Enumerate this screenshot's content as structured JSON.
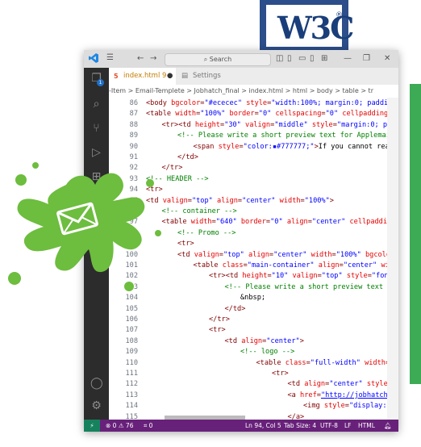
{
  "badge": {
    "w3c": "W3C",
    "reg": "®"
  },
  "titlebar": {
    "search_label": "Search"
  },
  "activity": {
    "badge_count": "1"
  },
  "tabs": [
    {
      "label": "index.html 9+",
      "dot": "●",
      "icon": "html-file-icon"
    },
    {
      "label": "Settings",
      "icon": "settings-file-icon"
    }
  ],
  "breadcrumb": {
    "text": "-Item > Email-Templete > Jobhatch_final > index.html > html > body > table > tr"
  },
  "lines": [
    {
      "n": "86",
      "indent": 0,
      "html": "<span class='tag'>&lt;body</span> <span class='attr'>bgcolor</span>=<span class='val'>\"#ececec\"</span> <span class='attr'>style</span>=<span class='val'>\"width:100%; margin:0; padding:0;\"</span>"
    },
    {
      "n": "87",
      "indent": 0,
      "html": "<span class='tag'>&lt;table</span> <span class='attr'>width</span>=<span class='val'>\"100%\"</span> <span class='attr'>border</span>=<span class='val'>\"0\"</span> <span class='attr'>cellspacing</span>=<span class='val'>\"0\"</span> <span class='attr'>cellpadding</span>=<span class='val'>\"0\"</span>"
    },
    {
      "n": "88",
      "indent": 1,
      "html": "<span class='tag'>&lt;tr&gt;&lt;td</span> <span class='attr'>height</span>=<span class='val'>\"30\"</span> <span class='attr'>valign</span>=<span class='val'>\"middle\"</span> <span class='attr'>style</span>=<span class='val'>\"margin:0; padding:</span>"
    },
    {
      "n": "89",
      "indent": 2,
      "html": "<span class='cm'>&lt;!-- Please write a short preview text for Applemail,Out</span>"
    },
    {
      "n": "90",
      "indent": 3,
      "html": "<span class='tag'>&lt;span</span> <span class='attr'>style</span>=<span class='val'>\"color:▪#777777;\"</span><span class='tag'>&gt;</span><span class='txt'>If you cannot read th</span>"
    },
    {
      "n": "91",
      "indent": 2,
      "html": "<span class='tag'>&lt;/td&gt;</span>"
    },
    {
      "n": "92",
      "indent": 1,
      "html": "<span class='tag'>&lt;/tr&gt;</span>"
    },
    {
      "n": "93",
      "indent": 0,
      "html": "<span class='cm'>&lt;!-- HEADER --&gt;</span>"
    },
    {
      "n": "94",
      "indent": 0,
      "html": "<span class='tag'>&lt;tr&gt;</span>"
    },
    {
      "n": "95",
      "indent": 0,
      "html": "<span class='tag'>&lt;td</span> <span class='attr'>valign</span>=<span class='val'>\"top\"</span> <span class='attr'>align</span>=<span class='val'>\"center\"</span> <span class='attr'>width</span>=<span class='val'>\"100%\"</span><span class='tag'>&gt;</span>"
    },
    {
      "n": "96",
      "indent": 1,
      "html": "<span class='cm'>&lt;!-- container --&gt;</span>"
    },
    {
      "n": "97",
      "indent": 1,
      "html": "<span class='tag'>&lt;table</span> <span class='attr'>width</span>=<span class='val'>\"640\"</span> <span class='attr'>border</span>=<span class='val'>\"0\"</span> <span class='attr'>align</span>=<span class='val'>\"center\"</span> <span class='attr'>cellpadding</span>=<span class='val'>\"0\"</span>"
    },
    {
      "n": "98",
      "indent": 2,
      "html": "<span class='cm'>&lt;!-- Promo --&gt;</span>"
    },
    {
      "n": "99",
      "indent": 2,
      "html": "<span class='tag'>&lt;tr&gt;</span>"
    },
    {
      "n": "100",
      "indent": 2,
      "html": "<span class='tag'>&lt;td</span> <span class='attr'>valign</span>=<span class='val'>\"top\"</span> <span class='attr'>align</span>=<span class='val'>\"center\"</span> <span class='attr'>width</span>=<span class='val'>\"100%\"</span> <span class='attr'>bgcolor</span>=<span class='val'>\"#</span>"
    },
    {
      "n": "101",
      "indent": 3,
      "html": "<span class='tag'>&lt;table</span> <span class='attr'>class</span>=<span class='val'>\"main-container\"</span> <span class='attr'>align</span>=<span class='val'>\"center\"</span> <span class='attr'>width</span>=<span class='val'>\"</span>"
    },
    {
      "n": "102",
      "indent": 4,
      "html": "<span class='tag'>&lt;tr&gt;&lt;td</span> <span class='attr'>height</span>=<span class='val'>\"10\"</span> <span class='attr'>valign</span>=<span class='val'>\"top\"</span> <span class='attr'>style</span>=<span class='val'>\"font-siz</span>"
    },
    {
      "n": "103",
      "indent": 5,
      "html": "<span class='cm'>&lt;!-- Please write a short preview text for A</span>"
    },
    {
      "n": "104",
      "indent": 6,
      "html": "<span class='txt'>&amp;nbsp;</span>"
    },
    {
      "n": "105",
      "indent": 5,
      "html": "<span class='tag'>&lt;/td&gt;</span>"
    },
    {
      "n": "106",
      "indent": 4,
      "html": "<span class='tag'>&lt;/tr&gt;</span>"
    },
    {
      "n": "107",
      "indent": 4,
      "html": "<span class='tag'>&lt;tr&gt;</span>"
    },
    {
      "n": "108",
      "indent": 5,
      "html": "<span class='tag'>&lt;td</span> <span class='attr'>align</span>=<span class='val'>\"center\"</span><span class='tag'>&gt;</span>"
    },
    {
      "n": "109",
      "indent": 6,
      "html": "<span class='cm'>&lt;!-- logo --&gt;</span>"
    },
    {
      "n": "110",
      "indent": 7,
      "html": "<span class='tag'>&lt;table</span> <span class='attr'>class</span>=<span class='val'>\"full-width\"</span> <span class='attr'>width</span>=<span class='val'>\"61</span>"
    },
    {
      "n": "111",
      "indent": 8,
      "html": "<span class='tag'>&lt;tr&gt;</span>"
    },
    {
      "n": "112",
      "indent": 9,
      "html": "<span class='tag'>&lt;td</span> <span class='attr'>align</span>=<span class='val'>\"center\"</span> <span class='attr'>style</span>=<span class='val'>\"li</span>"
    },
    {
      "n": "113",
      "indent": 9,
      "html": "<span class='tag'>&lt;a</span> <span class='attr'>href</span>=<span class='val' style='text-decoration:underline'>\"http://jobhatch.com</span>"
    },
    {
      "n": "114",
      "indent": 10,
      "html": "<span class='tag'>&lt;img</span> <span class='attr'>style</span>=<span class='val'>\"display:bloc</span>"
    },
    {
      "n": "115",
      "indent": 9,
      "html": "<span class='tag'>&lt;/a&gt;</span>"
    },
    {
      "n": "116",
      "indent": 9,
      "html": "<span class='tag'>&lt;/td&gt;</span>"
    },
    {
      "n": "117",
      "indent": 8,
      "html": "<span class='tag'>&lt;/tr&gt;</span>"
    },
    {
      "n": "118",
      "indent": 8,
      "html": "<span class='tag'>&lt;tr&gt;&lt;td</span> <span class='attr'>height</span>=<span class='val'>\"5\"</span>  <span class='attr'>valign</span>=<span class='val'>\"top\"</span>"
    }
  ],
  "status": {
    "remote": "⚡",
    "problems": "⊗ 0 ⚠ 76",
    "ports": "⌗ 0",
    "position": "Ln 94, Col 5",
    "tab_size": "Tab Size: 4",
    "encoding": "UTF-8",
    "eol": "LF",
    "language": "HTML"
  },
  "colors": {
    "accent": "#68217a",
    "green": "#3daa55",
    "w3c_blue": "#1a3e7a"
  }
}
